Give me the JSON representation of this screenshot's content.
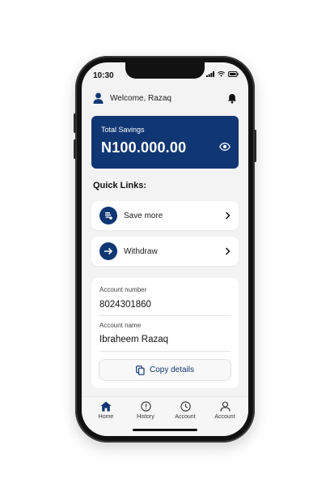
{
  "status_bar": {
    "time": "10:30",
    "icons": [
      "signal-icon",
      "wifi-icon",
      "battery-icon"
    ]
  },
  "header": {
    "welcome": "Welcome, Razaq",
    "user_icon": "user-icon",
    "notification_icon": "bell-icon"
  },
  "savings": {
    "label": "Total Savings",
    "amount": "N100.000.00",
    "toggle_icon": "eye-icon"
  },
  "quick_links": {
    "title": "Quick Links:",
    "items": [
      {
        "label": "Save more",
        "icon": "save-money-icon"
      },
      {
        "label": "Withdraw",
        "icon": "arrow-right-icon"
      }
    ]
  },
  "account": {
    "number_label": "Account number",
    "number": "8024301860",
    "name_label": "Account name",
    "name": "Ibraheem Razaq",
    "copy_label": "Copy details",
    "copy_icon": "copy-icon"
  },
  "nav": {
    "items": [
      {
        "label": "Home",
        "icon": "home-icon",
        "active": true
      },
      {
        "label": "History",
        "icon": "history-icon",
        "active": false
      },
      {
        "label": "Account",
        "icon": "clock-icon",
        "active": false
      },
      {
        "label": "Account",
        "icon": "person-icon",
        "active": false
      }
    ]
  },
  "colors": {
    "primary": "#103673",
    "background": "#f3f3f3",
    "card": "#ffffff"
  }
}
